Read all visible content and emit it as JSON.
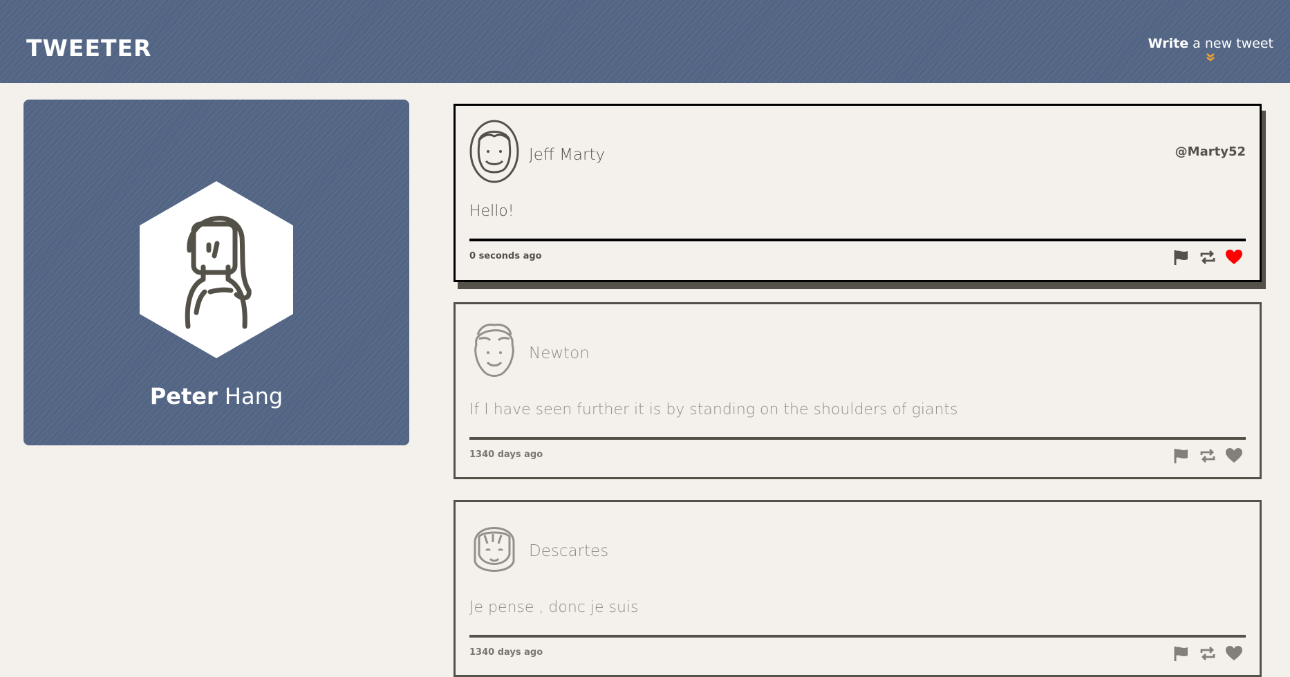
{
  "header": {
    "logo": "TWEETER",
    "compose_bold": "Write",
    "compose_rest": " a new tweet",
    "compose_icon": "double-chevron-down-icon",
    "accent_color": "#f2a22b"
  },
  "profile": {
    "first_name": "Peter",
    "last_name": "Hang",
    "avatar_icon": "woman-avatar-icon",
    "card_color": "#546685"
  },
  "tweets": [
    {
      "name": "Jeff Marty",
      "handle": "@Marty52",
      "content": "Hello!",
      "time": "0 seconds ago",
      "liked": true,
      "like_color": "#ff0000"
    },
    {
      "name": "Newton",
      "handle": "",
      "content": "If I have seen further it is by standing on the shoulders of giants",
      "time": "1340 days ago",
      "liked": false
    },
    {
      "name": "Descartes",
      "handle": "",
      "content": "Je pense , donc je suis",
      "time": "1340 days ago",
      "liked": false
    }
  ],
  "actions": [
    "flag-icon",
    "retweet-icon",
    "heart-icon"
  ]
}
